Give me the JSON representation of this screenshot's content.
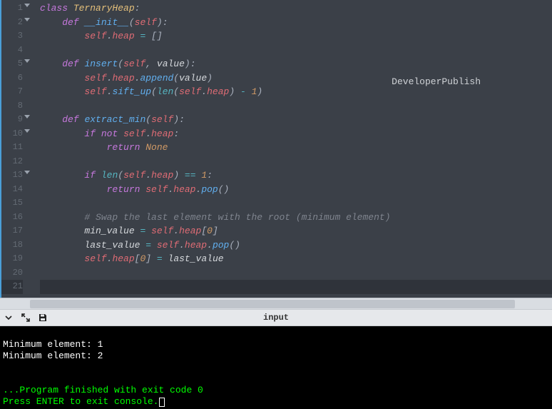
{
  "watermark": "DeveloperPublish",
  "gutter": {
    "lines": [
      "1",
      "2",
      "3",
      "4",
      "5",
      "6",
      "7",
      "8",
      "9",
      "10",
      "11",
      "12",
      "13",
      "14",
      "15",
      "16",
      "17",
      "18",
      "19",
      "20",
      "21"
    ],
    "folds": [
      1,
      2,
      5,
      9,
      10,
      13
    ]
  },
  "code": {
    "l1": {
      "kw": "class",
      "sp": " ",
      "cls": "TernaryHeap",
      "pun": ":"
    },
    "l2": {
      "indent": "    ",
      "kw": "def",
      "sp": " ",
      "fn": "__init__",
      "p1": "(",
      "self": "self",
      "p2": "):"
    },
    "l3": {
      "indent": "        ",
      "self": "self",
      "dot": ".",
      "prop": "heap",
      "sp": " ",
      "op": "=",
      "sp2": " ",
      "br": "[]"
    },
    "l4": "",
    "l5": {
      "indent": "    ",
      "kw": "def",
      "sp": " ",
      "fn": "insert",
      "p1": "(",
      "self": "self",
      "c": ", ",
      "arg": "value",
      "p2": "):"
    },
    "l6": {
      "indent": "        ",
      "self": "self",
      "dot": ".",
      "prop": "heap",
      "dot2": ".",
      "m": "append",
      "p1": "(",
      "arg": "value",
      "p2": ")"
    },
    "l7": {
      "indent": "        ",
      "self": "self",
      "dot": ".",
      "m": "sift_up",
      "p1": "(",
      "bi": "len",
      "p2": "(",
      "self2": "self",
      "dot2": ".",
      "prop": "heap",
      "p3": ") ",
      "op": "-",
      "sp": " ",
      "num": "1",
      "p4": ")"
    },
    "l8": "",
    "l9": {
      "indent": "    ",
      "kw": "def",
      "sp": " ",
      "fn": "extract_min",
      "p1": "(",
      "self": "self",
      "p2": "):"
    },
    "l10": {
      "indent": "        ",
      "kw": "if",
      "sp": " ",
      "kw2": "not",
      "sp2": " ",
      "self": "self",
      "dot": ".",
      "prop": "heap",
      "pun": ":"
    },
    "l11": {
      "indent": "            ",
      "kw": "return",
      "sp": " ",
      "const": "None"
    },
    "l12": "",
    "l13": {
      "indent": "        ",
      "kw": "if",
      "sp": " ",
      "bi": "len",
      "p1": "(",
      "self": "self",
      "dot": ".",
      "prop": "heap",
      "p2": ") ",
      "op": "==",
      "sp2": " ",
      "num": "1",
      "pun": ":"
    },
    "l14": {
      "indent": "            ",
      "kw": "return",
      "sp": " ",
      "self": "self",
      "dot": ".",
      "prop": "heap",
      "dot2": ".",
      "m": "pop",
      "p": "()"
    },
    "l15": "",
    "l16": {
      "indent": "        ",
      "cmt": "# Swap the last element with the root (minimum element)"
    },
    "l17": {
      "indent": "        ",
      "var": "min_value ",
      "op": "=",
      "sp": " ",
      "self": "self",
      "dot": ".",
      "prop": "heap",
      "b1": "[",
      "num": "0",
      "b2": "]"
    },
    "l18": {
      "indent": "        ",
      "var": "last_value ",
      "op": "=",
      "sp": " ",
      "self": "self",
      "dot": ".",
      "prop": "heap",
      "dot2": ".",
      "m": "pop",
      "p": "()"
    },
    "l19": {
      "indent": "        ",
      "self": "self",
      "dot": ".",
      "prop": "heap",
      "b1": "[",
      "num": "0",
      "b2": "] ",
      "op": "=",
      "sp": " ",
      "var": "last_value"
    },
    "l20": "",
    "l21": ""
  },
  "toolbar": {
    "label": "input"
  },
  "console": {
    "out1": "Minimum element: 1",
    "out2": "Minimum element: 2",
    "blank1": "",
    "blank2": "",
    "exit": "...Program finished with exit code 0",
    "prompt": "Press ENTER to exit console."
  }
}
